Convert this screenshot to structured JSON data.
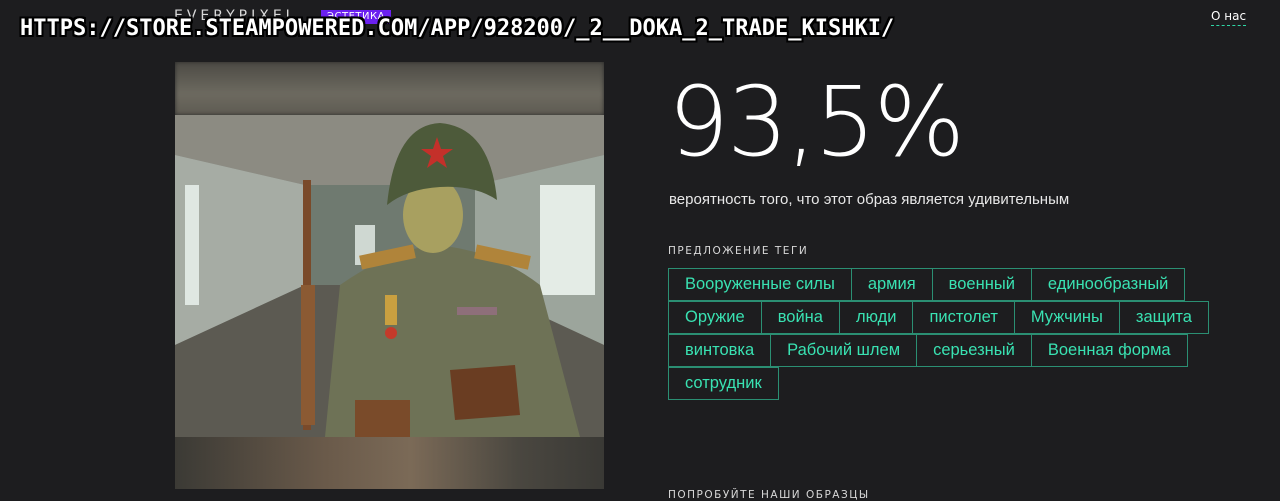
{
  "header": {
    "logo": "EVERYPIXEL",
    "badge": "ЭСТЕТИКА",
    "about_link": "О нас"
  },
  "overlay_text": "HTTPS://STORE.STEAMPOWERED.COM/APP/928200/_2__DOKA_2_TRADE_KISHKI/",
  "result": {
    "score": "93,5%",
    "caption": "вероятность того, что этот образ является удивительным"
  },
  "tags_section": {
    "label": "ПРЕДЛОЖЕНИЕ ТЕГИ",
    "rows": [
      [
        "Вооруженные силы",
        "армия",
        "военный",
        "единообразный"
      ],
      [
        "Оружие",
        "война",
        "люди",
        "пистолет",
        "Мужчины",
        "защита"
      ],
      [
        "винтовка",
        "Рабочий шлем",
        "серьезный",
        "Военная форма"
      ],
      [
        "сотрудник"
      ]
    ]
  },
  "samples_section": {
    "label": "ПОПРОБУЙТЕ НАШИ ОБРАЗЦЫ"
  },
  "colors": {
    "background": "#1d1d1f",
    "accent": "#39e2b2",
    "tag_border": "#2b8f73",
    "badge": "#6b20f0"
  }
}
